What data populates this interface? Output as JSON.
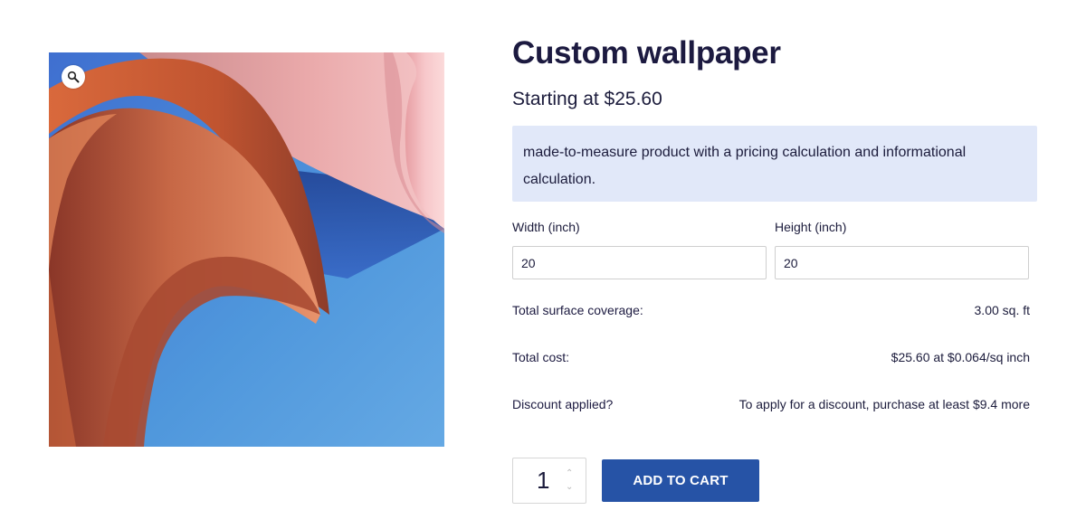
{
  "product": {
    "title": "Custom wallpaper",
    "price": "Starting at $25.60",
    "description": "made-to-measure product with a pricing calculation and informational calculation."
  },
  "gallery": {
    "image_alt": "Orange and pink paper curls on blue background",
    "zoom_icon": "magnifier-icon"
  },
  "calculator": {
    "width_label": "Width (inch)",
    "width_value": "20",
    "height_label": "Height (inch)",
    "height_value": "20",
    "coverage_label": "Total surface coverage:",
    "coverage_value": "3.00 sq. ft",
    "cost_label": "Total cost:",
    "cost_value": "$25.60 at $0.064/sq inch",
    "discount_label": "Discount applied?",
    "discount_value": "To apply for a discount, purchase at least $9.4 more"
  },
  "cart": {
    "quantity": "1",
    "add_label": "ADD TO CART"
  },
  "colors": {
    "accent": "#2653a6",
    "info_bg": "#e1e8f9",
    "heading": "#1c1a40"
  }
}
